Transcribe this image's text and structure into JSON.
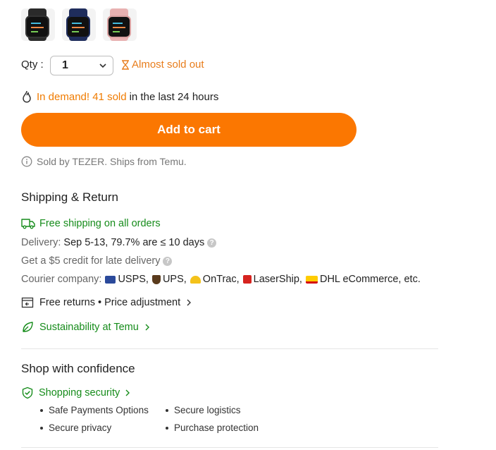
{
  "variants": [
    {
      "name": "black",
      "band_color": "#2a2a2a"
    },
    {
      "name": "navy",
      "band_color": "#1f2d5c"
    },
    {
      "name": "pink",
      "band_color": "#e8b1b1"
    }
  ],
  "quantity": {
    "label": "Qty :",
    "value": "1",
    "stock_status": "Almost sold out"
  },
  "demand": {
    "prefix": "In demand! 41 sold",
    "suffix": "in the last 24 hours"
  },
  "cart": {
    "button_label": "Add to cart"
  },
  "seller": {
    "text": "Sold by TEZER. Ships from Temu."
  },
  "shipping": {
    "title": "Shipping & Return",
    "free_shipping": "Free shipping on all orders",
    "delivery_label": "Delivery:",
    "delivery_value": "Sep 5-13, 79.7% are ≤ 10 days",
    "credit": "Get a $5 credit for late delivery",
    "courier_label": "Courier company:",
    "couriers": [
      "USPS,",
      "UPS,",
      "OnTrac,",
      "LaserShip,",
      "DHL eCommerce, etc."
    ],
    "returns": "Free returns • Price adjustment",
    "sustainability": "Sustainability at Temu"
  },
  "confidence": {
    "title": "Shop with confidence",
    "security_link": "Shopping security",
    "items": [
      "Safe Payments Options",
      "Secure logistics",
      "Secure privacy",
      "Purchase protection"
    ]
  },
  "colors": {
    "accent": "#fb7701",
    "warning": "#e87d1c",
    "success": "#168c1b"
  }
}
